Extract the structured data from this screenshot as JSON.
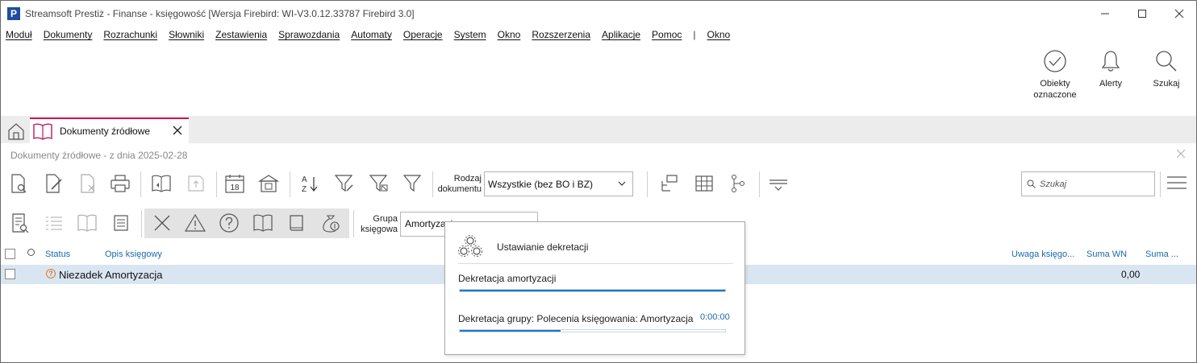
{
  "window": {
    "title": "Streamsoft Prestiż - Finanse - księgowość [Wersja Firebird: WI-V3.0.12.33787 Firebird 3.0]",
    "logo_letter": "P"
  },
  "menu": [
    "Moduł",
    "Dokumenty",
    "Rozrachunki",
    "Słowniki",
    "Zestawienia",
    "Sprawozdania",
    "Automaty",
    "Operacje",
    "System",
    "Okno",
    "Rozszerzenia",
    "Aplikacje",
    "Pomoc"
  ],
  "menu_separator": "|",
  "menu_extra": "Okno",
  "quick_actions": {
    "marked_line1": "Obiekty",
    "marked_line2": "oznaczone",
    "alerts": "Alerty",
    "search": "Szukaj"
  },
  "tab": {
    "label": "Dokumenty źródłowe"
  },
  "panel": {
    "header": "Dokumenty źródłowe - z dnia 2025-02-28"
  },
  "toolbar": {
    "doc_type_label_line1": "Rodzaj",
    "doc_type_label_line2": "dokumentu",
    "doc_type_value": "Wszystkie (bez BO i BZ)",
    "calendar_day": "18",
    "sort_a": "A",
    "sort_z": "Z",
    "search_placeholder": "Szukaj",
    "group_label_line1": "Grupa",
    "group_label_line2": "księgowa",
    "group_value": "Amortyzacja"
  },
  "grid": {
    "columns": {
      "status": "Status",
      "description": "Opis księgowy",
      "note": "Uwaga księgo...",
      "sum_wn": "Suma WN",
      "sum_ma": "Suma ..."
    },
    "rows": [
      {
        "status": "Niezadek",
        "status_icon": "?",
        "description": "Amortyzacja",
        "sum_wn": "0,00"
      }
    ]
  },
  "progress_dialog": {
    "title": "Ustawianie dekretacji",
    "task1_label": "Dekretacja amortyzacji",
    "task1_progress": 1.0,
    "task2_label": "Dekretacja grupy: Polecenia księgowania: Amortyzacja",
    "task2_time": "0:00:00",
    "task2_progress": 0.38
  },
  "colors": {
    "accent": "#1c78c4",
    "tab_border": "#c2185b",
    "row_selected": "#d9e6f1",
    "link_blue": "#1c6aa8",
    "status_orange": "#e07b2a"
  }
}
